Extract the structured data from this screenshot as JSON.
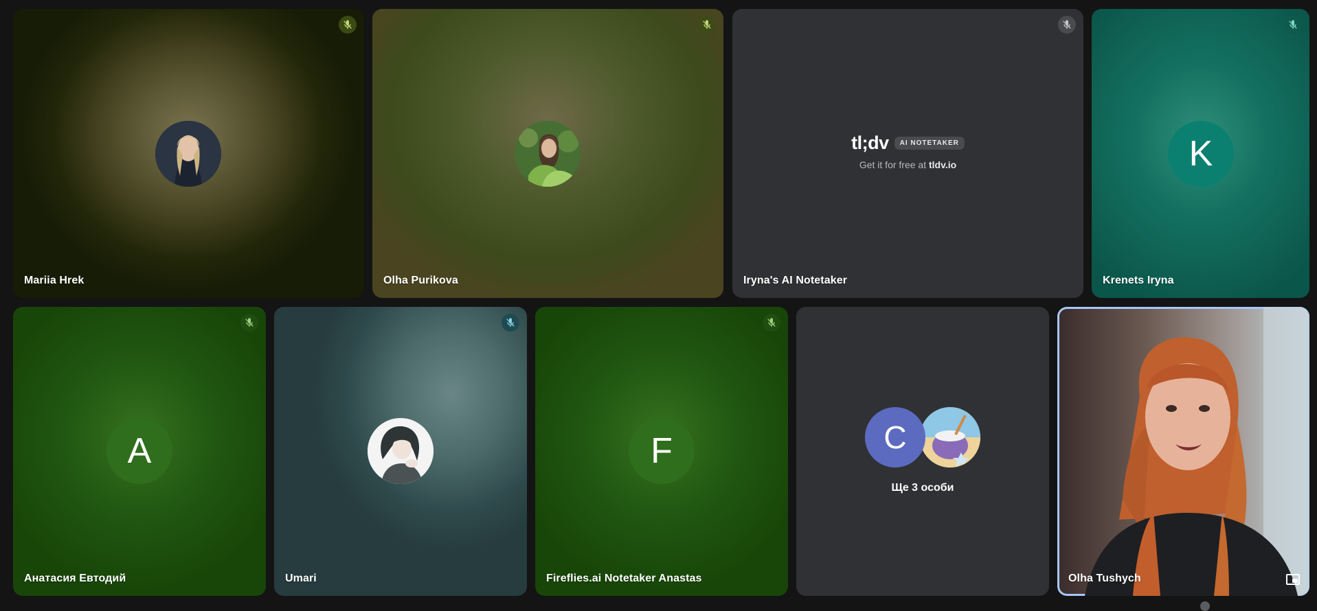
{
  "participants": [
    {
      "name": "Mariia Hrek",
      "muted": true,
      "avatar": "photo"
    },
    {
      "name": "Olha Purikova",
      "muted": true,
      "avatar": "photo"
    },
    {
      "name": "Iryna's AI Notetaker",
      "muted": true,
      "avatar": "tldv-logo"
    },
    {
      "name": "Krenets Iryna",
      "muted": true,
      "avatar": "K"
    },
    {
      "name": "Анатасия Евтодий",
      "muted": true,
      "avatar": "A"
    },
    {
      "name": "Umari",
      "muted": true,
      "avatar": "anime-illustration"
    },
    {
      "name": "Fireflies.ai Notetaker Anastas",
      "muted": true,
      "avatar": "F"
    },
    {
      "name": "Olha Tushych",
      "muted": false,
      "avatar": "live-video",
      "speaking": true
    }
  ],
  "tldv": {
    "brand": "tl;dv",
    "badge": "AI NOTETAKER",
    "tagline": "Get it for free at",
    "link": "tldv.io"
  },
  "overflow": {
    "avatar_letter": "C",
    "label": "Ще 3 особи"
  },
  "icons": {
    "mic_off": "mic-off-icon",
    "pip": "picture-in-picture-icon"
  },
  "colors": {
    "speaking_border": "#a8c7fa",
    "tile_dark": "#303134",
    "background": "#141414"
  }
}
